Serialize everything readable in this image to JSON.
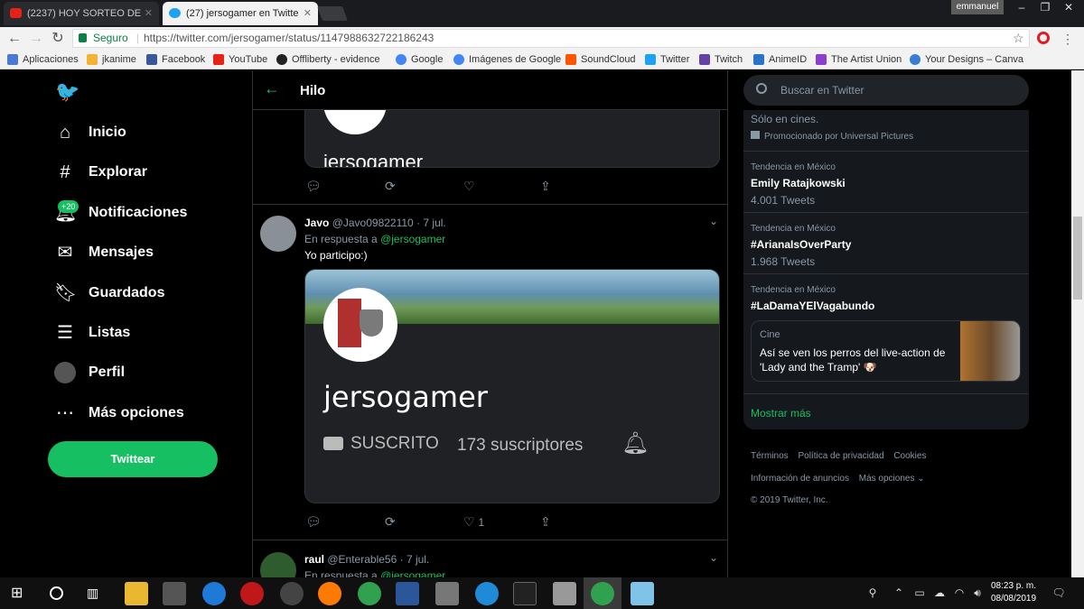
{
  "browser": {
    "tabs": [
      {
        "title": "(2237) HOY SORTEO DE",
        "active": false
      },
      {
        "title": "(27) jersogamer en Twitte",
        "active": true
      }
    ],
    "user": "emmanuel",
    "secure_label": "Seguro",
    "url": "https://twitter.com/jersogamer/status/1147988632722186243",
    "bookmarks": [
      "Aplicaciones",
      "jkanime",
      "Facebook",
      "YouTube",
      "Offliberty - evidence",
      "Google",
      "Imágenes de Google",
      "SoundCloud",
      "Twitter",
      "Twitch",
      "AnimeID",
      "The Artist Union",
      "Your Designs – Canva"
    ]
  },
  "nav": {
    "items": [
      {
        "label": "Inicio",
        "icon": "home-icon"
      },
      {
        "label": "Explorar",
        "icon": "hashtag-icon"
      },
      {
        "label": "Notificaciones",
        "icon": "bell-icon",
        "badge": "+20"
      },
      {
        "label": "Mensajes",
        "icon": "mail-icon"
      },
      {
        "label": "Guardados",
        "icon": "bookmark-icon"
      },
      {
        "label": "Listas",
        "icon": "list-icon"
      },
      {
        "label": "Perfil",
        "icon": "avatar-icon"
      },
      {
        "label": "Más opciones",
        "icon": "more-icon"
      }
    ],
    "tweet_button": "Twittear"
  },
  "thread": {
    "title": "Hilo",
    "prev_card_name": "jersogamer",
    "tweets": [
      {
        "name": "Javo",
        "handle": "@Javo09822110",
        "date": "· 7 jul.",
        "reply_prefix": "En respuesta a",
        "reply_to": "@jersogamer",
        "text": "Yo participo:)",
        "card": {
          "channel": "jersogamer",
          "status": "SUSCRITO",
          "subscribers": "173 suscriptores"
        },
        "likes": "1"
      },
      {
        "name": "raul",
        "handle": "@Enterable56",
        "date": "· 7 jul.",
        "reply_prefix": "En respuesta a",
        "reply_to": "@jersogamer"
      }
    ]
  },
  "sidebar": {
    "search_placeholder": "Buscar en Twitter",
    "promo_text": "Sólo en cines.",
    "promo_by": "Promocionado por Universal Pictures",
    "trends": [
      {
        "context": "Tendencia en México",
        "name": "Emily Ratajkowski",
        "count": "4.001 Tweets"
      },
      {
        "context": "Tendencia en México",
        "name": "#ArianaIsOverParty",
        "count": "1.968 Tweets"
      },
      {
        "context": "Tendencia en México",
        "name": "#LaDamaYElVagabundo"
      }
    ],
    "news": {
      "category": "Cine",
      "text": "Así se ven los perros del live-action de 'Lady and the Tramp' 🐶"
    },
    "show_more": "Mostrar más",
    "footer": [
      "Términos",
      "Política de privacidad",
      "Cookies",
      "Información de anuncios",
      "Más opciones",
      "© 2019 Twitter, Inc."
    ]
  },
  "taskbar": {
    "time": "08:23 p. m.",
    "date": "08/08/2019"
  }
}
